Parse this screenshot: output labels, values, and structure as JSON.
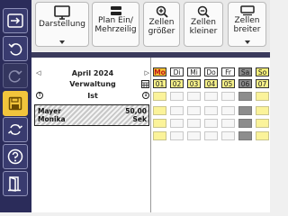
{
  "toolbar": {
    "darstellung": "Darstellung",
    "plan": "Plan Ein/\nMehrzeilig",
    "zellen_groesser": "Zellen\ngrößer",
    "zellen_kleiner": "Zellen\nkleiner",
    "zellen_breiter": "Zellen\nbreiter"
  },
  "planner": {
    "month": "April 2024",
    "department": "Verwaltung",
    "ist_label": "Ist",
    "employees": [
      {
        "name": "Mayer",
        "value": "50,00"
      },
      {
        "name": "Monika",
        "value": "Sek"
      }
    ]
  },
  "days": [
    {
      "label": "Mo",
      "date": "01"
    },
    {
      "label": "Di",
      "date": "02"
    },
    {
      "label": "Mi",
      "date": "03"
    },
    {
      "label": "Do",
      "date": "04"
    },
    {
      "label": "Fr",
      "date": "05"
    },
    {
      "label": "Sa",
      "date": "06"
    },
    {
      "label": "So",
      "date": "07"
    }
  ],
  "colors": {
    "sidebar": "#2b2c5a",
    "active_button": "#f2c43c",
    "monday": "#f6c333",
    "saturday": "#8a8a8a",
    "date_row": "#f5f08a"
  }
}
